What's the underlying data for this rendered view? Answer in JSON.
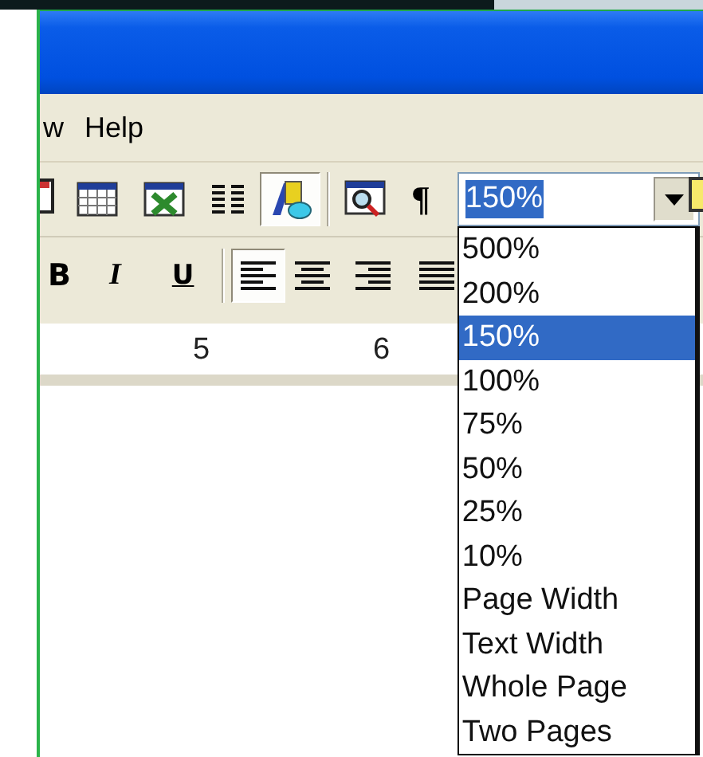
{
  "menu": [
    {
      "label": "w"
    },
    {
      "label": "Help"
    }
  ],
  "standard_toolbar": [
    {
      "kind": "partial"
    },
    {
      "kind": "table",
      "pressed": false
    },
    {
      "kind": "worksheet",
      "pressed": false
    },
    {
      "kind": "columns",
      "pressed": false
    },
    {
      "kind": "drawing",
      "pressed": true
    },
    {
      "kind": "separator"
    },
    {
      "kind": "preview",
      "pressed": false
    },
    {
      "kind": "glyph",
      "label": "¶",
      "pressed": false
    }
  ],
  "zoom_box": {
    "value": "150%",
    "expanded": true,
    "options": [
      {
        "label": "500%",
        "selected": false
      },
      {
        "label": "200%",
        "selected": false
      },
      {
        "label": "150%",
        "selected": true
      },
      {
        "label": "100%",
        "selected": false
      },
      {
        "label": "75%",
        "selected": false
      },
      {
        "label": "50%",
        "selected": false
      },
      {
        "label": "25%",
        "selected": false
      },
      {
        "label": "10%",
        "selected": false
      },
      {
        "label": "Page Width",
        "selected": false
      },
      {
        "label": "Text Width",
        "selected": false
      },
      {
        "label": "Whole Page",
        "selected": false
      },
      {
        "label": "Two Pages",
        "selected": false
      }
    ]
  },
  "formatting_toolbar": [
    {
      "kind": "bold",
      "label": "B",
      "pressed": false
    },
    {
      "kind": "italic",
      "label": "I",
      "pressed": false
    },
    {
      "kind": "underline",
      "label": "U",
      "pressed": false
    },
    {
      "kind": "separator"
    },
    {
      "kind": "align-left",
      "pressed": true
    },
    {
      "kind": "align-center",
      "pressed": false
    },
    {
      "kind": "align-right",
      "pressed": false
    },
    {
      "kind": "justify",
      "pressed": false
    }
  ],
  "ruler": {
    "labels": [
      "5",
      "6"
    ]
  }
}
